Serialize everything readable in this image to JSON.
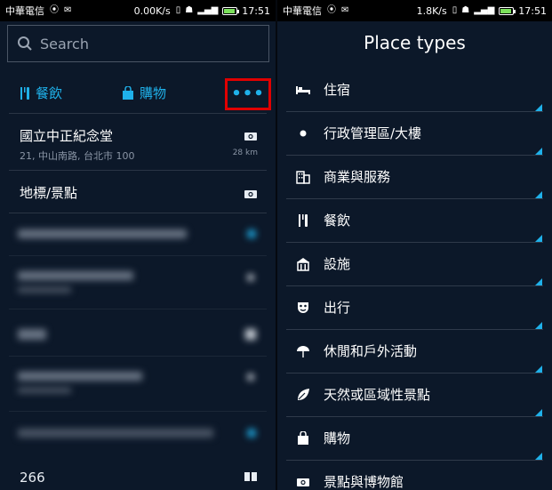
{
  "left": {
    "status": {
      "carrier": "中華電信",
      "speed": "0.00K/s",
      "time": "17:51"
    },
    "search": {
      "placeholder": "Search"
    },
    "categories": [
      {
        "label": "餐飲",
        "icon": "cutlery-icon"
      },
      {
        "label": "購物",
        "icon": "shopping-bag-icon"
      }
    ],
    "more_label": "•••",
    "results": [
      {
        "name": "國立中正紀念堂",
        "address": "21, 中山南路, 台北市 100",
        "distance": "28 km",
        "icon": "camera-icon"
      },
      {
        "name": "地標/景點",
        "icon": "camera-icon"
      }
    ],
    "count": "266"
  },
  "right": {
    "status": {
      "carrier": "中華電信",
      "speed": "1.8K/s",
      "time": "17:51"
    },
    "title": "Place types",
    "types": [
      {
        "label": "住宿",
        "icon": "bed-icon"
      },
      {
        "label": "行政管理區/大樓",
        "icon": "dot-icon"
      },
      {
        "label": "商業與服務",
        "icon": "building-icon"
      },
      {
        "label": "餐飲",
        "icon": "cutlery-icon"
      },
      {
        "label": "設施",
        "icon": "facility-icon"
      },
      {
        "label": "出行",
        "icon": "mask-icon"
      },
      {
        "label": "休閒和戶外活動",
        "icon": "umbrella-icon"
      },
      {
        "label": "天然或區域性景點",
        "icon": "leaf-icon"
      },
      {
        "label": "購物",
        "icon": "shopping-bag-icon"
      },
      {
        "label": "景點與博物館",
        "icon": "camera-icon"
      }
    ]
  },
  "colors": {
    "accent": "#1fb1ea",
    "highlight": "#e00000",
    "background": "#0c1829"
  }
}
